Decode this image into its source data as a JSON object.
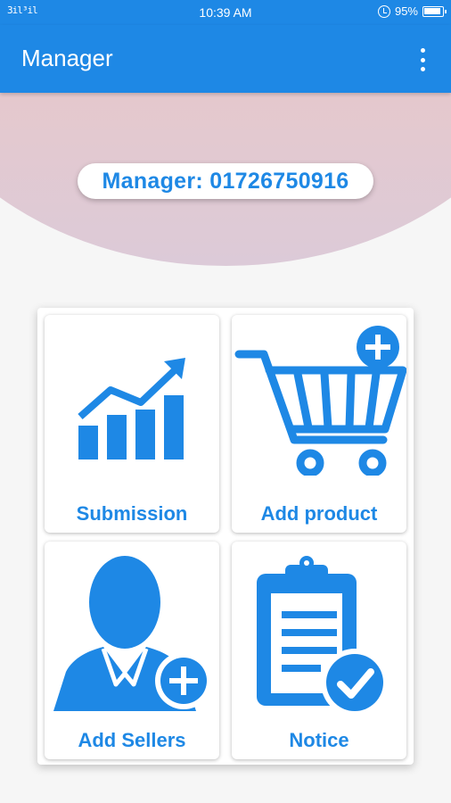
{
  "status_bar": {
    "signal": "3il³il",
    "time": "10:39 AM",
    "battery_percent": "95%"
  },
  "app_bar": {
    "title": "Manager",
    "menu_icon": "more-vert-icon"
  },
  "header": {
    "manager_label": "Manager: 01726750916"
  },
  "tiles": [
    {
      "label": "Submission",
      "icon": "bar-chart-trend-icon"
    },
    {
      "label": "Add product",
      "icon": "cart-add-icon"
    },
    {
      "label": "Add Sellers",
      "icon": "person-add-icon"
    },
    {
      "label": "Notice",
      "icon": "clipboard-check-icon"
    }
  ],
  "colors": {
    "primary": "#1e88e5",
    "header_gradient_top": "#eec9bd",
    "header_gradient_bottom": "#dccad8",
    "background": "#f6f6f6"
  }
}
